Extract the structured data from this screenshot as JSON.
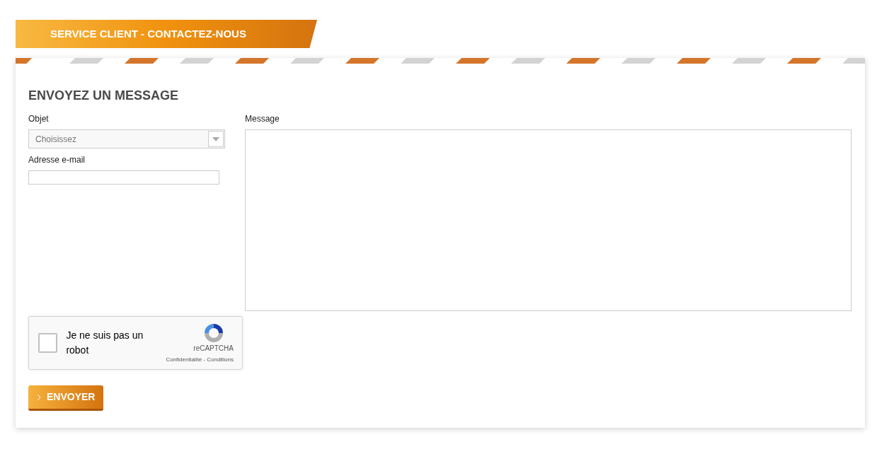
{
  "banner": {
    "title": "SERVICE CLIENT - CONTACTEZ-NOUS"
  },
  "form": {
    "heading": "ENVOYEZ UN MESSAGE",
    "subject": {
      "label": "Objet",
      "placeholder": "Choisissez"
    },
    "email": {
      "label": "Adresse e-mail"
    },
    "message": {
      "label": "Message"
    },
    "captcha": {
      "label": "Je ne suis pas un robot",
      "checked": false,
      "brand": "reCAPTCHA",
      "links": "Confidentialité - Conditions"
    },
    "submit": {
      "label": "ENVOYER"
    }
  }
}
